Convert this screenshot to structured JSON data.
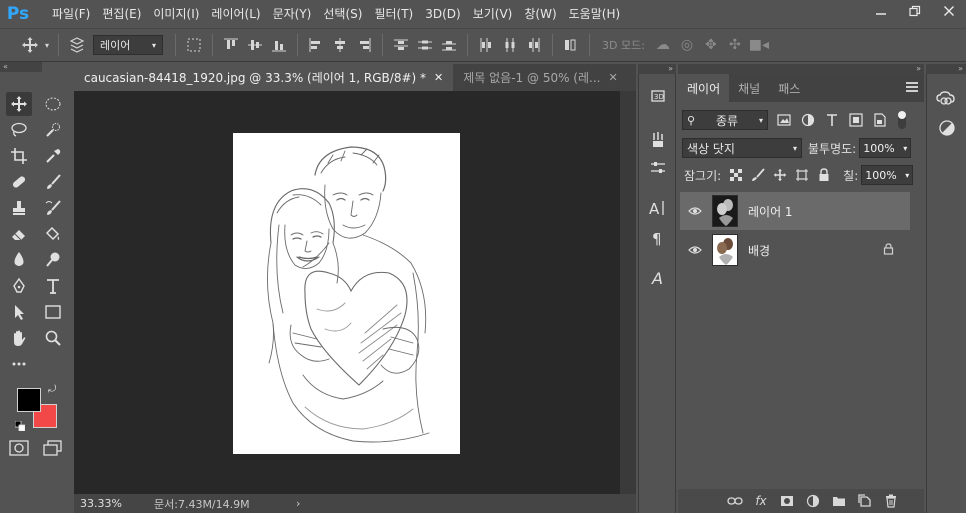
{
  "app": {
    "logo": "Ps",
    "menu": [
      "파일(F)",
      "편집(E)",
      "이미지(I)",
      "레이어(L)",
      "문자(Y)",
      "선택(S)",
      "필터(T)",
      "3D(D)",
      "보기(V)",
      "창(W)",
      "도움말(H)"
    ],
    "window_controls": [
      "minimize-icon",
      "restore-icon",
      "close-icon"
    ]
  },
  "options_bar": {
    "auto_select_value": "레이어",
    "mode_3d_label": "3D 모드:"
  },
  "tabs": [
    {
      "title": "caucasian-84418_1920.jpg @ 33.3% (레이어 1, RGB/8#) *",
      "active": true
    },
    {
      "title": "제목 없음-1 @ 50% (레...",
      "active": false
    }
  ],
  "status": {
    "zoom": "33.33%",
    "doc_size": "문서:7.43M/14.9M"
  },
  "colors": {
    "foreground": "#000000",
    "background": "#f24848",
    "accent": "#31a8ff"
  },
  "layers_panel": {
    "tabs": [
      "레이어",
      "채널",
      "패스"
    ],
    "filter_kind": "종류",
    "blend_mode": "색상 닷지",
    "opacity_label": "불투명도:",
    "opacity_value": "100%",
    "lock_label": "잠그기:",
    "fill_label": "칠:",
    "fill_value": "100%",
    "layers": [
      {
        "name": "레이어 1",
        "visible": true,
        "selected": true,
        "locked": false,
        "thumbnail": "inverted"
      },
      {
        "name": "배경",
        "visible": true,
        "selected": false,
        "locked": true,
        "thumbnail": "normal"
      }
    ]
  }
}
